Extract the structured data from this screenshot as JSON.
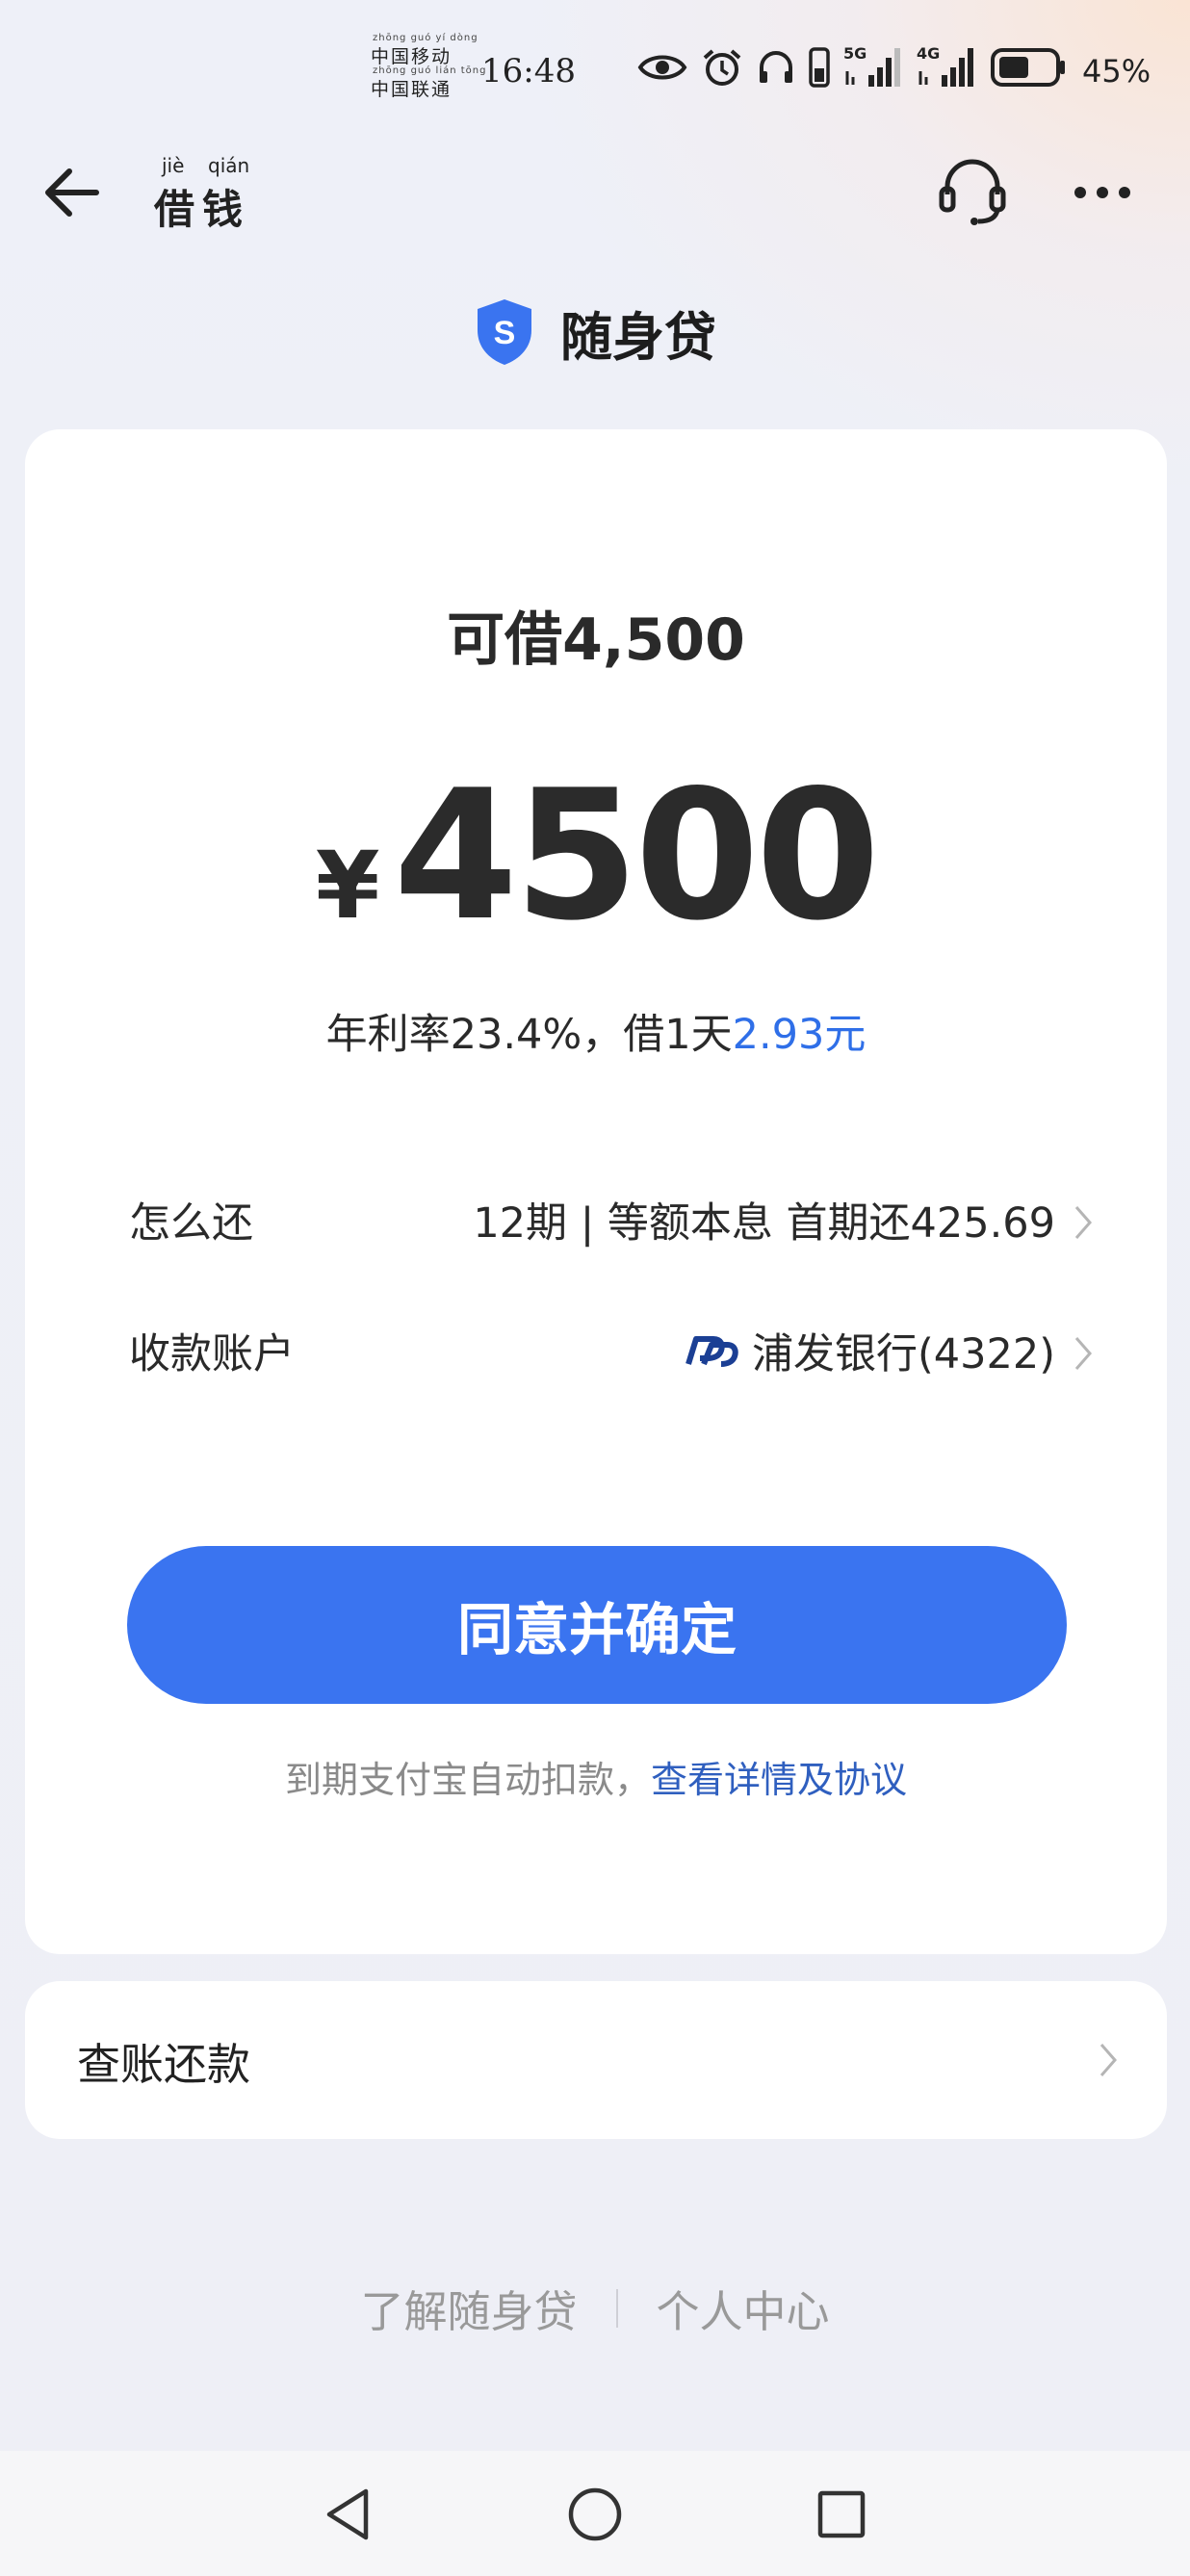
{
  "status_bar": {
    "carrier_line1": "中国移动",
    "carrier_line1_pinyin": "zhōng guó  yí  dòng",
    "carrier_line2": "中国联通",
    "carrier_line2_pinyin": "zhōng guó lián tōng",
    "time": "16:48",
    "network_1": "5G",
    "network_2": "4G",
    "battery": "45%",
    "icons": [
      "eye-icon",
      "alarm-icon",
      "headphones-icon",
      "phone-battery-icon",
      "signal-5g-icon",
      "signal-4g-icon",
      "battery-icon"
    ]
  },
  "header": {
    "title": "借钱",
    "title_pinyin_1": "jiè",
    "title_pinyin_2": "qián",
    "icons": [
      "back-arrow-icon",
      "headset-icon",
      "more-icon"
    ]
  },
  "product": {
    "name": "随身贷",
    "logo_letter": "S",
    "logo_color": "#3a74f0"
  },
  "loan": {
    "available_text": "可借4,500",
    "currency": "¥",
    "amount": "4500",
    "rate_prefix": "年利率23.4%，借1天",
    "rate_highlight": "2.93元",
    "repay_label": "怎么还",
    "repay_value": "12期 | 等额本息 首期还425.69",
    "account_label": "收款账户",
    "account_value": "浦发银行(4322)",
    "confirm_label": "同意并确定",
    "agreement_text": "到期支付宝自动扣款，",
    "agreement_link": "查看详情及协议"
  },
  "bill": {
    "label": "查账还款"
  },
  "footer": {
    "link_1": "了解随身贷",
    "link_2": "个人中心"
  },
  "colors": {
    "accent": "#3a74f0",
    "link": "#2f6fe8",
    "bank_logo": "#1b3f94"
  }
}
